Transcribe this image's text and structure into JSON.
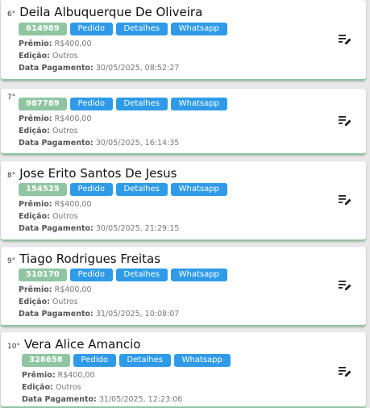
{
  "cards": [
    {
      "position": "6°",
      "name": "Deila Albuquerque De Oliveira",
      "code": "614989",
      "premio_label": "Prêmio:",
      "premio": "R$400,00",
      "edicao_label": "Edição:",
      "edicao": "Outros",
      "data_label": "Data Pagamento:",
      "data": "30/05/2025, 08:52:27"
    },
    {
      "position": "7°",
      "name": "",
      "code": "987789",
      "premio_label": "Prêmio:",
      "premio": "R$400,00",
      "edicao_label": "Edição:",
      "edicao": "Outros",
      "data_label": "Data Pagamento:",
      "data": "30/05/2025, 16:14:35"
    },
    {
      "position": "8°",
      "name": "Jose Erito Santos De Jesus",
      "code": "154525",
      "premio_label": "Prêmio:",
      "premio": "R$400,00",
      "edicao_label": "Edição:",
      "edicao": "Outros",
      "data_label": "Data Pagamento:",
      "data": "30/05/2025, 21:29:15"
    },
    {
      "position": "9°",
      "name": "Tiago Rodrigues Freitas",
      "code": "510170",
      "premio_label": "Prêmio:",
      "premio": "R$400,00",
      "edicao_label": "Edição:",
      "edicao": "Outros",
      "data_label": "Data Pagamento:",
      "data": "31/05/2025, 10:08:07"
    },
    {
      "position": "10°",
      "name": "Vera Alice Amancio",
      "code": "328658",
      "premio_label": "Prêmio:",
      "premio": "R$400,00",
      "edicao_label": "Edição:",
      "edicao": "Outros",
      "data_label": "Data Pagamento:",
      "data": "31/05/2025, 12:23:06"
    }
  ],
  "buttons": {
    "pedido": "Pedido",
    "detalhes": "Detalhes",
    "whatsapp": "Whatsapp"
  },
  "icons": {
    "edit": "edit-list-icon"
  },
  "colors": {
    "code_badge": "#8fc6a1",
    "button": "#2f9be8",
    "card_border": "#8fc6a1"
  }
}
